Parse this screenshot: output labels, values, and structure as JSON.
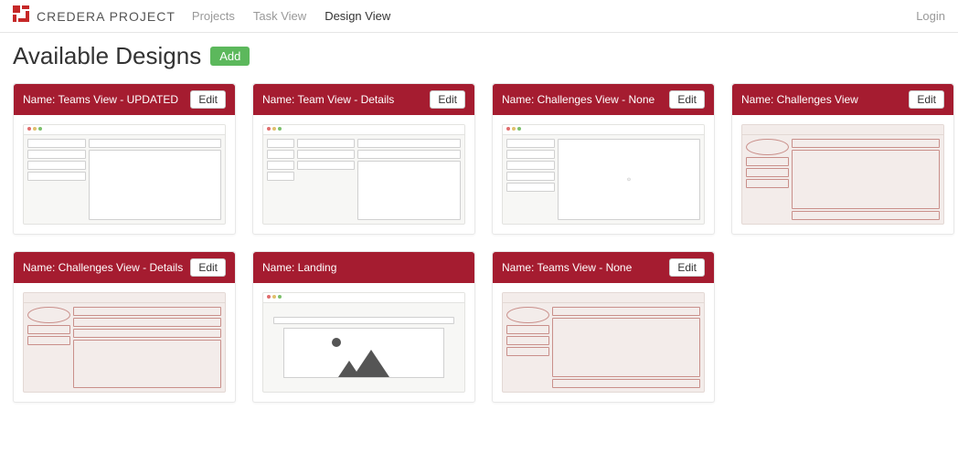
{
  "brand": {
    "text": "CREDERA PROJECT"
  },
  "nav": {
    "projects": "Projects",
    "task_view": "Task View",
    "design_view": "Design View",
    "login": "Login"
  },
  "page": {
    "title": "Available Designs",
    "add_label": "Add",
    "edit_label": "Edit"
  },
  "designs": [
    {
      "name": "Name: Teams View - UPDATED"
    },
    {
      "name": "Name: Team View - Details"
    },
    {
      "name": "Name: Challenges View - None"
    },
    {
      "name": "Name: Challenges View"
    },
    {
      "name": "Name: Challenges View - Details"
    },
    {
      "name": "Name: Landing"
    },
    {
      "name": "Name: Teams View - None"
    }
  ]
}
